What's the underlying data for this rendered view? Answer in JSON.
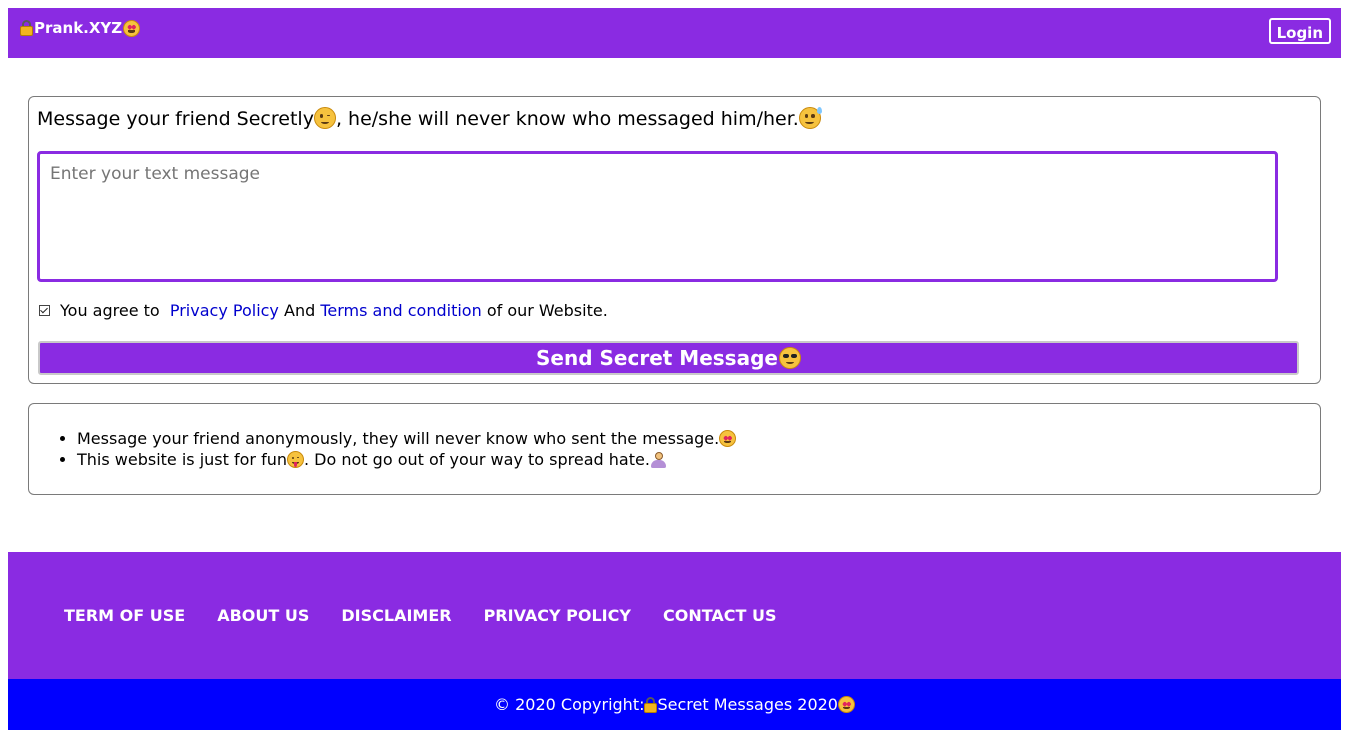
{
  "header": {
    "brand": "Prank.XYZ",
    "brand_icons": [
      "lock-icon",
      "heart-eyes-emoji-icon"
    ],
    "login_label": "Login"
  },
  "form": {
    "intro_part1": "Message your friend Secretly",
    "intro_part2": ", he/she will never know who messaged him/her.",
    "intro_icons": [
      "winking-face-icon",
      "grinning-sweat-face-icon"
    ],
    "message_placeholder": "Enter your text message",
    "message_value": "",
    "agree_checked": true,
    "agree_prefix": "You agree to",
    "privacy_link": "Privacy Policy",
    "and_text": "And",
    "terms_link": "Terms and condition",
    "agree_suffix": "of our Website.",
    "send_label": "Send Secret Message",
    "send_icon": "sunglasses-face-icon"
  },
  "info": {
    "items": [
      {
        "text": "Message your friend anonymously, they will never know who sent the message.",
        "icon": "heart-eyes-emoji-icon"
      },
      {
        "text_before": "This website is just for fun",
        "text_after": ". Do not go out of your way to spread hate.",
        "icons": [
          "winking-tongue-face-icon",
          "person-gesturing-icon"
        ]
      }
    ]
  },
  "footer": {
    "links": [
      "TERM OF USE",
      "ABOUT US",
      "DISCLAIMER",
      "PRIVACY POLICY",
      "CONTACT US"
    ],
    "copyright_prefix": "© 2020 Copyright:",
    "copyright_brand": "Secret Messages 2020"
  },
  "colors": {
    "brand_purple": "#8a2be2",
    "copyright_blue": "#0000ff",
    "link_blue": "#0000cd",
    "white": "#ffffff"
  }
}
